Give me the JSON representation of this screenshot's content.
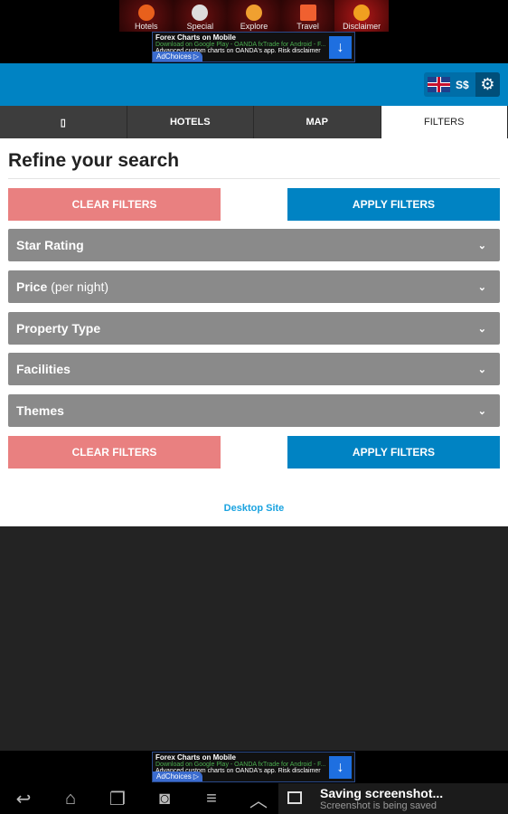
{
  "top_apps": [
    {
      "label": "Hotels",
      "color": "#e8601c"
    },
    {
      "label": "Special",
      "color": "#ddd"
    },
    {
      "label": "Explore",
      "color": "#f0a030"
    },
    {
      "label": "Travel",
      "color": "#f06030"
    },
    {
      "label": "Disclaimer",
      "color": "#f0a020"
    }
  ],
  "ad": {
    "title": "Forex Charts on Mobile",
    "line1": "Download on Google Play - OANDA fxTrade for Android - F...",
    "line2": "Advanced custom charts on OANDA's app. Risk disclaimer",
    "adchoices": "AdChoices ▷",
    "download_icon": "arrow-down-icon"
  },
  "header": {
    "currency": "S$",
    "language_flag": "uk-flag",
    "settings_icon": "gear-icon"
  },
  "tabs": [
    {
      "label": ""
    },
    {
      "label": "HOTELS"
    },
    {
      "label": "MAP"
    },
    {
      "label": "FILTERS",
      "active": true
    }
  ],
  "main": {
    "title": "Refine your search",
    "clear_label": "CLEAR FILTERS",
    "apply_label": "APPLY FILTERS",
    "sections": [
      {
        "label": "Star Rating",
        "sub": ""
      },
      {
        "label": "Price",
        "sub": "(per night)"
      },
      {
        "label": "Property Type",
        "sub": ""
      },
      {
        "label": "Facilities",
        "sub": ""
      },
      {
        "label": "Themes",
        "sub": ""
      }
    ],
    "desktop_link": "Desktop Site"
  },
  "notification": {
    "title": "Saving screenshot...",
    "subtitle": "Screenshot is being saved"
  },
  "colors": {
    "accent": "#0083c3",
    "clear": "#e98080",
    "section": "#8a8a8a"
  }
}
